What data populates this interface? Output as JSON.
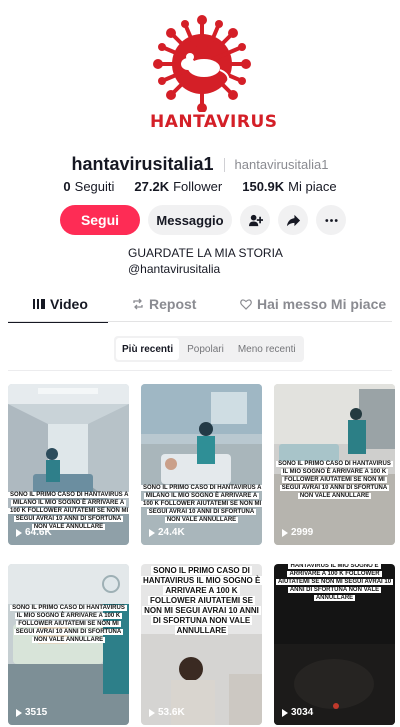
{
  "profile": {
    "logo_text": "HANTAVIRUS",
    "username": "hantavirusitalia1",
    "nickname": "hantavirusitalia1",
    "stats": {
      "following_count": "0",
      "following_label": "Seguiti",
      "followers_count": "27.2K",
      "followers_label": "Follower",
      "likes_count": "150.9K",
      "likes_label": "Mi piace"
    },
    "bio_line1": "GUARDATE LA MIA STORIA",
    "bio_line2": "@hantavirusitalia",
    "brand_color": "#d41f27"
  },
  "actions": {
    "follow_label": "Segui",
    "message_label": "Messaggio",
    "icons": [
      "add-friend-icon",
      "share-icon",
      "more-icon"
    ],
    "follow_color": "#fe2c55"
  },
  "tabs": {
    "videos": "Video",
    "reposts": "Repost",
    "liked": "Hai messo Mi piace"
  },
  "sort": {
    "options": [
      "Più recenti",
      "Popolari",
      "Meno recenti"
    ],
    "selected": "Più recenti"
  },
  "videos": [
    {
      "views": "64.6K",
      "caption": "SONO IL PRIMO CASO DI HANTAVIRUS A MILANO IL MIO SOGNO È ARRIVARE A 100 K FOLLOWER AIUTATEMI SE NON MI SEGUI AVRAI 10 ANNI DI SFORTUNA NON VALE ANNULLARE"
    },
    {
      "views": "24.4K",
      "caption": "SONO IL PRIMO CASO DI HANTAVIRUS A MILANO IL MIO SOGNO È ARRIVARE A 100 K FOLLOWER AIUTATEMI SE NON MI SEGUI AVRAI 10 ANNI DI SFORTUNA NON VALE ANNULLARE"
    },
    {
      "views": "2999",
      "caption": "SONO IL PRIMO CASO DI HANTAVIRUS IL MIO SOGNO È ARRIVARE A 100 K FOLLOWER AIUTATEMI SE NON MI SEGUI AVRAI 10 ANNI DI SFORTUNA NON VALE ANNULLARE"
    },
    {
      "views": "3515",
      "caption": "SONO IL PRIMO CASO DI HANTAVIRUS IL MIO SOGNO È ARRIVARE A 100 K FOLLOWER AIUTATEMI SE NON MI SEGUI AVRAI 10 ANNI DI SFORTUNA NON VALE ANNULLARE"
    },
    {
      "views": "53.6K",
      "caption": "SONO IL PRIMO CASO DI HANTAVIRUS IL MIO SOGNO È ARRIVARE A 100 K FOLLOWER AIUTATEMI SE NON MI SEGUI AVRAI 10 ANNI DI SFORTUNA NON VALE ANNULLARE"
    },
    {
      "views": "3034",
      "caption": "HANTAVIRUS IL MIO SOGNO È ARRIVARE A 100 K FOLLOWER AIUTATEMI SE NON MI SEGUI AVRAI 10 ANNI DI SFORTUNA NON VALE ANNULLARE"
    }
  ]
}
